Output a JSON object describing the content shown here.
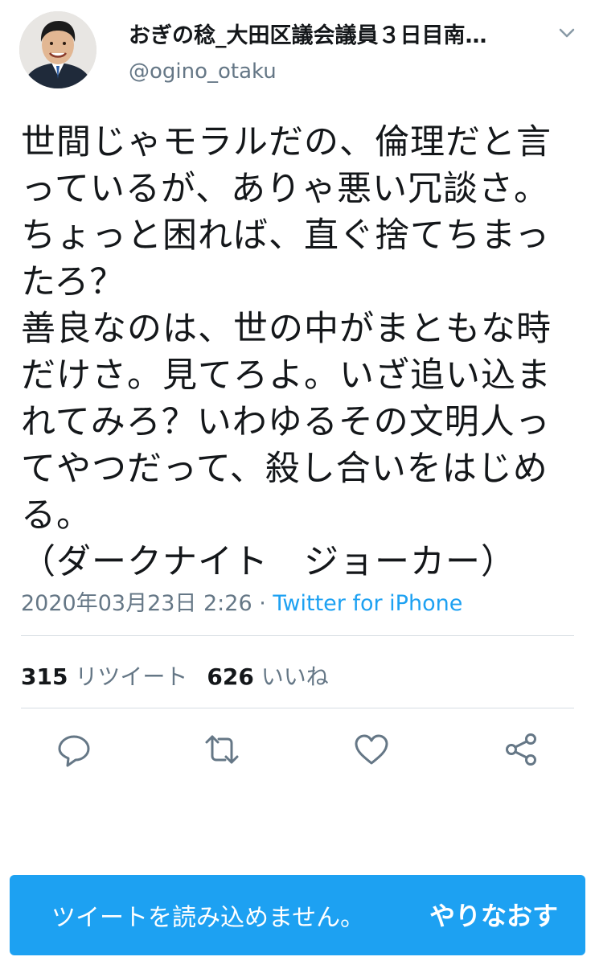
{
  "author": {
    "display_name": "おぎの稔_大田区議会議員３日目南…",
    "handle": "@ogino_otaku"
  },
  "tweet": {
    "text": "世間じゃモラルだの、倫理だと言っているが、ありゃ悪い冗談さ。ちょっと困れば、直ぐ捨てちまったろ？\n善良なのは、世の中がまともな時だけさ。見てろよ。いざ追い込まれてみろ？いわゆるその文明人ってやつだって、殺し合いをはじめる。\n（ダークナイト　ジョーカー）",
    "timestamp": "2020年03月23日 2:26 · ",
    "source": "Twitter for iPhone"
  },
  "stats": {
    "retweet_count": "315",
    "retweet_label": "リツイート",
    "like_count": "626",
    "like_label": "いいね"
  },
  "actions": {
    "icons": [
      "reply-icon",
      "retweet-icon",
      "like-icon",
      "share-icon"
    ]
  },
  "toast": {
    "message": "ツイートを読み込めません。",
    "retry_label": "やりなおす"
  },
  "colors": {
    "accent": "#1da1f2",
    "text": "#14171a",
    "secondary": "#657786",
    "divider": "#d6dde2"
  }
}
